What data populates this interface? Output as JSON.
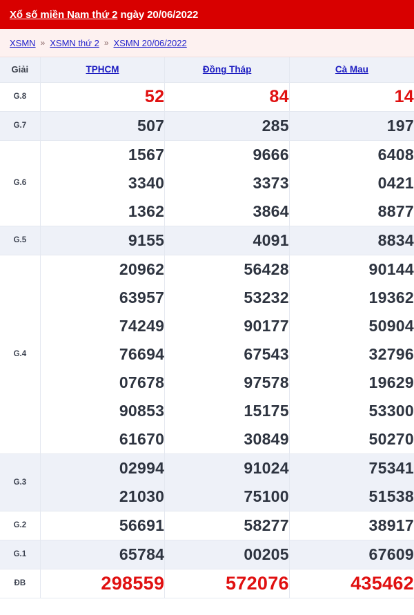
{
  "header": {
    "title_link": "Xổ số miền Nam thứ 2",
    "title_rest": " ngày 20/06/2022",
    "bg_color": "#d80000"
  },
  "breadcrumb": {
    "separator": "»",
    "items": [
      {
        "label": "XSMN"
      },
      {
        "label": "XSMN thứ 2"
      },
      {
        "label": "XSMN 20/06/2022"
      }
    ]
  },
  "table": {
    "columns": [
      {
        "key": "label",
        "header": "Giải",
        "is_link": false
      },
      {
        "key": "tphcm",
        "header": "TPHCM",
        "is_link": true
      },
      {
        "key": "dongthap",
        "header": "Đồng Tháp",
        "is_link": true
      },
      {
        "key": "camau",
        "header": "Cà Mau",
        "is_link": true
      }
    ],
    "rows": [
      {
        "prize": "G.8",
        "style": "plain",
        "emphasis": "g8",
        "tphcm": "52",
        "dongthap": "84",
        "camau": "14"
      },
      {
        "prize": "G.7",
        "style": "shade",
        "emphasis": "none",
        "tphcm": "507",
        "dongthap": "285",
        "camau": "197"
      },
      {
        "prize": "G.6",
        "style": "plain",
        "emphasis": "none",
        "tphcm": "1567\n3340\n1362",
        "dongthap": "9666\n3373\n3864",
        "camau": "6408\n0421\n8877"
      },
      {
        "prize": "G.5",
        "style": "shade",
        "emphasis": "none",
        "tphcm": "9155",
        "dongthap": "4091",
        "camau": "8834"
      },
      {
        "prize": "G.4",
        "style": "plain",
        "emphasis": "none",
        "tphcm": "20962\n63957\n74249\n76694\n07678\n90853\n61670",
        "dongthap": "56428\n53232\n90177\n67543\n97578\n15175\n30849",
        "camau": "90144\n19362\n50904\n32796\n19629\n53300\n50270"
      },
      {
        "prize": "G.3",
        "style": "shade",
        "emphasis": "none",
        "tphcm": "02994\n21030",
        "dongthap": "91024\n75100",
        "camau": "75341\n51538"
      },
      {
        "prize": "G.2",
        "style": "plain",
        "emphasis": "none",
        "tphcm": "56691",
        "dongthap": "58277",
        "camau": "38917"
      },
      {
        "prize": "G.1",
        "style": "shade",
        "emphasis": "none",
        "tphcm": "65784",
        "dongthap": "00205",
        "camau": "67609"
      },
      {
        "prize": "ĐB",
        "style": "plain",
        "emphasis": "db",
        "tphcm": "298559",
        "dongthap": "572076",
        "camau": "435462"
      }
    ]
  },
  "colors": {
    "header_red": "#d80000",
    "breadcrumb_bg": "#fdf1f0",
    "link_blue": "#1a1ac0",
    "shade_row": "#eef1f8",
    "number_red": "#e01010",
    "number_dark": "#2e3440"
  }
}
